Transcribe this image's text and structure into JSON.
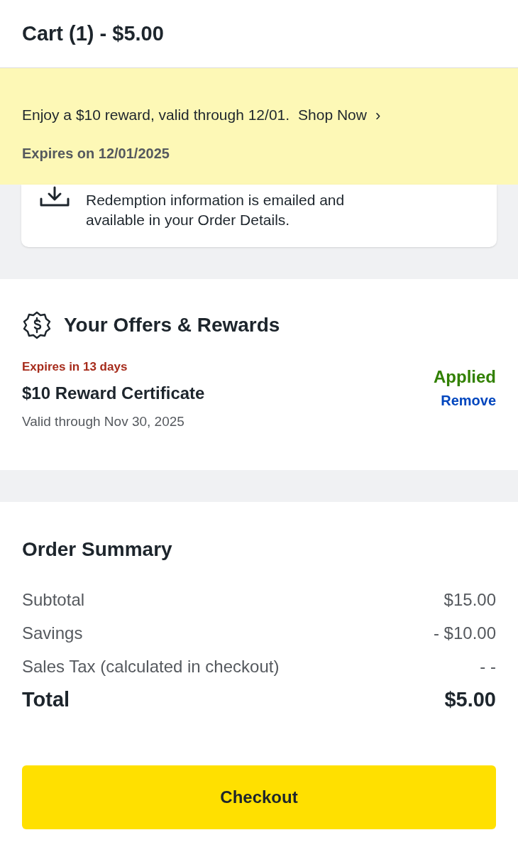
{
  "header": {
    "title": "Cart (1) - $5.00"
  },
  "banner": {
    "message": "Enjoy a $10 reward, valid through 12/01.",
    "link": "Shop Now",
    "link_icon": "›",
    "expiry": "Expires on 12/01/2025"
  },
  "delivery_card": {
    "text": "Redemption information is emailed and available in your Order Details."
  },
  "offers": {
    "title": "Your Offers & Rewards",
    "items": [
      {
        "expiry": "Expires in 13 days",
        "name": "$10 Reward Certificate",
        "validity": "Valid through Nov 30, 2025",
        "status": "Applied",
        "action": "Remove"
      }
    ]
  },
  "order_summary": {
    "title": "Order Summary",
    "rows": [
      {
        "kind": "line",
        "label": "Subtotal",
        "value": "$15.00"
      },
      {
        "kind": "line",
        "label": "Savings",
        "value": "- $10.00"
      },
      {
        "kind": "line",
        "label": "Sales Tax (calculated in checkout)",
        "value": "- -"
      },
      {
        "kind": "total",
        "label": "Total",
        "value": "$5.00"
      }
    ]
  },
  "checkout_button": "Checkout"
}
